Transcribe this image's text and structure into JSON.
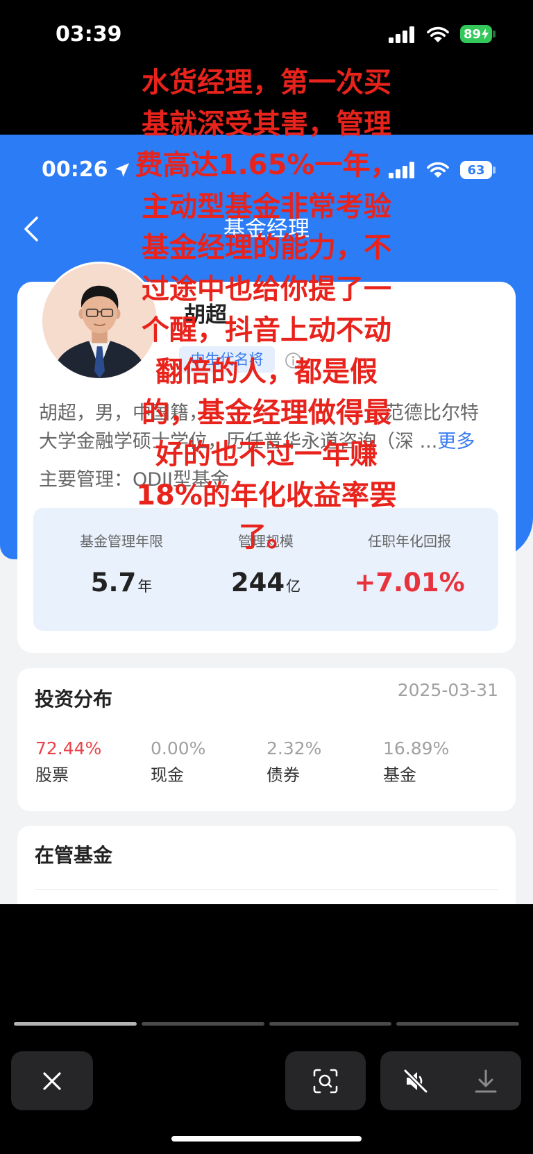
{
  "outer_status": {
    "time": "03:39",
    "battery_level": "89",
    "charging": true
  },
  "inner_status": {
    "time": "00:26",
    "battery_level": "63"
  },
  "header": {
    "title": "基金经理"
  },
  "manager": {
    "name": "胡超",
    "badge": "中生代名将",
    "bio": {
      "line1_start": "胡超，男，中国籍，",
      "line1_end": "范德比尔特",
      "line2": "大学金融学硕士学位，历任普华永道咨询（深",
      "ellipsis": " ...",
      "more_link": "更多"
    },
    "main_manage": "主要管理：QDII型基金"
  },
  "stats": [
    {
      "label": "基金管理年限",
      "value": "5.7",
      "unit": "年"
    },
    {
      "label": "管理规模",
      "value": "244",
      "unit": "亿"
    },
    {
      "label": "任职年化回报",
      "value": "+7.01%"
    }
  ],
  "allocation": {
    "title": "投资分布",
    "date": "2025-03-31",
    "items": [
      {
        "percent": "72.44%",
        "label": "股票"
      },
      {
        "percent": "0.00%",
        "label": "现金"
      },
      {
        "percent": "2.32%",
        "label": "债券"
      },
      {
        "percent": "16.89%",
        "label": "基金"
      }
    ]
  },
  "managed_funds": {
    "title": "在管基金"
  },
  "overlay": {
    "color": "#e8231c",
    "lines": [
      "水货经理，第一次买",
      "基就深受其害，管理",
      "费高达1.65%一年，",
      "主动型基金非常考验",
      "基金经理的能力，不",
      "过途中也给你提了一",
      "个醒，抖音上动不动",
      "翻倍的人，都是假",
      "的，基金经理做得最",
      "好的也不过一年赚",
      "18%的年化收益率罢",
      "了。"
    ]
  },
  "viewer": {
    "segment_count": 4,
    "current_segment": 1
  },
  "icons": {
    "back": "chevron-left-icon",
    "info": "info-icon",
    "close": "close-icon",
    "scan": "visual-search-icon",
    "mute": "speaker-muted-icon",
    "download": "download-icon",
    "signal": "cellular-signal-icon",
    "wifi": "wifi-icon",
    "location": "location-arrow-icon",
    "charging": "charging-bolt-icon"
  },
  "colors": {
    "accent_blue": "#2c7cf6",
    "positive_red": "#e8333c",
    "battery_green": "#34c759",
    "badge_blue": "#3a7cf0",
    "stats_bg": "#e9f1fd"
  }
}
